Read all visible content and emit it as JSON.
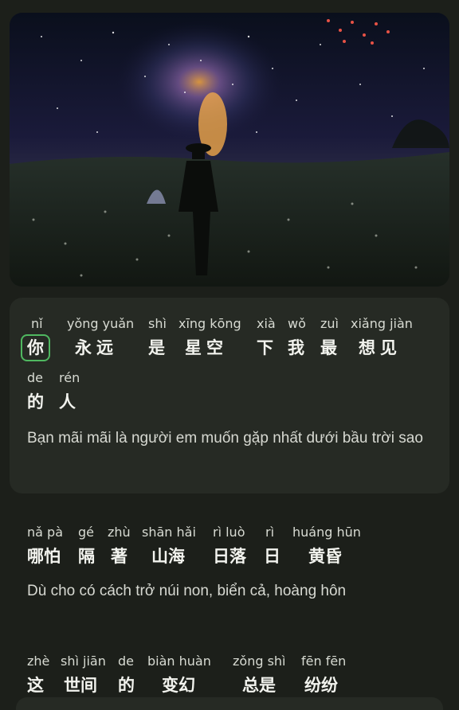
{
  "lyrics": [
    {
      "words": [
        {
          "py": "nǐ",
          "hz": "你"
        },
        {
          "py": "yǒng yuǎn",
          "hz": "永远"
        },
        {
          "py": "shì",
          "hz": "是"
        },
        {
          "py": "xīng kōng",
          "hz": "星空"
        },
        {
          "py": "xià",
          "hz": "下"
        },
        {
          "py": "wǒ",
          "hz": "我"
        },
        {
          "py": "zuì",
          "hz": "最"
        },
        {
          "py": "xiǎng jiàn",
          "hz": "想见"
        },
        {
          "py": "de",
          "hz": "的"
        },
        {
          "py": "rén",
          "hz": "人"
        }
      ],
      "translation": "Bạn mãi mãi là người em muốn gặp nhất dưới bầu trời sao"
    },
    {
      "words": [
        {
          "py": "nǎ pà",
          "hz": "哪怕"
        },
        {
          "py": "gé",
          "hz": "隔"
        },
        {
          "py": "zhù",
          "hz": "著"
        },
        {
          "py": "shān hǎi",
          "hz": "山海"
        },
        {
          "py": "rì luò",
          "hz": "日落"
        },
        {
          "py": "rì",
          "hz": "日"
        },
        {
          "py": "huáng hūn",
          "hz": "黄昏"
        }
      ],
      "translation": "Dù cho có cách trở núi non, biển cả, hoàng hôn"
    },
    {
      "words": [
        {
          "py": "zhè",
          "hz": "这"
        },
        {
          "py": "shì jiān",
          "hz": "世间"
        },
        {
          "py": "de",
          "hz": "的"
        },
        {
          "py": "biàn huàn",
          "hz": "变幻"
        },
        {
          "py": "zǒng shì",
          "hz": "总是"
        },
        {
          "py": "fēn fēn",
          "hz": "纷纷"
        }
      ]
    }
  ],
  "colors": {
    "background": "#1c1f1a",
    "active_card": "#262a24",
    "highlight_border": "#4fb860"
  }
}
